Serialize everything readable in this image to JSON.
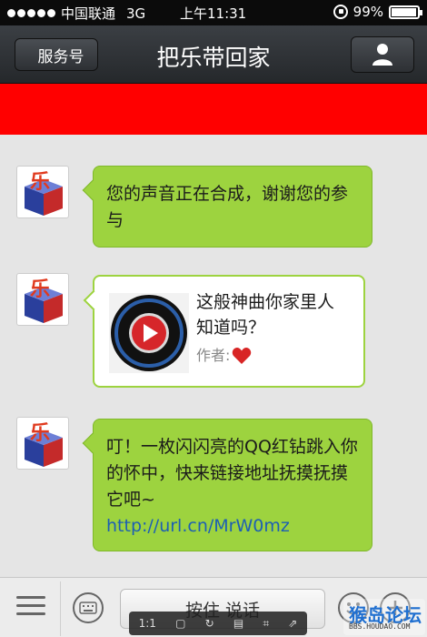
{
  "status_bar": {
    "carrier": "中国联通",
    "network": "3G",
    "time": "上午11:31",
    "battery": "99%"
  },
  "nav": {
    "back_label": "服务号",
    "title": "把乐带回家",
    "profile_icon": "person-icon"
  },
  "messages": [
    {
      "type": "text",
      "text": "您的声音正在合成，谢谢您的参与"
    },
    {
      "type": "card",
      "title": "这般神曲你家里人知道吗？",
      "author_label": "作者:",
      "author_icon": "heart-icon"
    },
    {
      "type": "text",
      "text": "叮！一枚闪闪亮的QQ红钻跳入你的怀中，快来链接地址抚摸抚摸它吧~",
      "link": "http://url.cn/MrW0mz"
    }
  ],
  "avatar_label": "乐",
  "input_bar": {
    "hold_to_talk": "按住 说话",
    "menu_icon": "menu-icon",
    "keyboard_icon": "keyboard-icon",
    "emoji_icon": "emoji-icon",
    "plus_icon": "plus-icon"
  },
  "viewer_toolbar": {
    "zoom": "1:1"
  },
  "watermark": {
    "main": "猴岛论坛",
    "sub": "BBS.HOUDAO.COM"
  },
  "colors": {
    "nav_bg": "#2f3236",
    "banner": "#ff0000",
    "bubble_green": "#9dd33f",
    "chat_bg": "#e5e5e5",
    "link": "#1d5fb3"
  }
}
